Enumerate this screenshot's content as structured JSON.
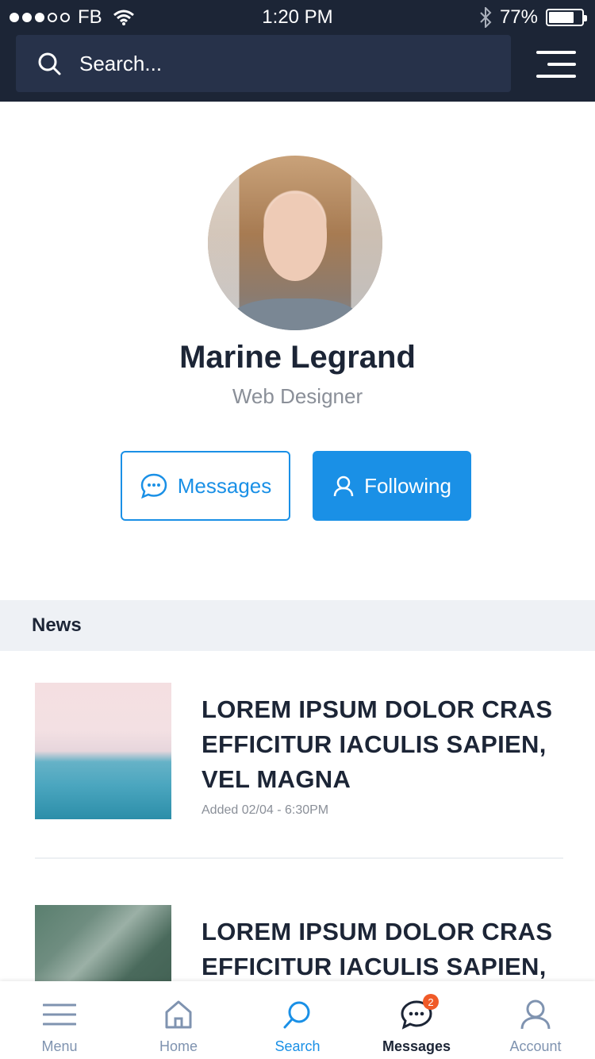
{
  "status_bar": {
    "carrier": "FB",
    "time": "1:20 PM",
    "battery_percent": "77%",
    "battery_level": 0.77,
    "signal_bars_filled": 3,
    "signal_bars_total": 5
  },
  "header": {
    "search_placeholder": "Search...",
    "menu_icon": "hamburger-icon"
  },
  "profile": {
    "name": "Marine Legrand",
    "role": "Web Designer",
    "messages_button": "Messages",
    "following_button": "Following"
  },
  "news": {
    "section_title": "News",
    "items": [
      {
        "title": "LOREM IPSUM DOLOR CRAS EFFICITUR IACULIS SAPIEN, VEL MAGNA",
        "date": "Added 02/04 - 6:30PM"
      },
      {
        "title": "LOREM IPSUM DOLOR CRAS EFFICITUR IACULIS SAPIEN, VEL",
        "date": ""
      }
    ]
  },
  "tabbar": {
    "tabs": [
      {
        "label": "Menu",
        "icon": "menu-icon"
      },
      {
        "label": "Home",
        "icon": "home-icon"
      },
      {
        "label": "Search",
        "icon": "search-icon"
      },
      {
        "label": "Messages",
        "icon": "chat-icon",
        "badge": "2"
      },
      {
        "label": "Account",
        "icon": "user-icon"
      }
    ],
    "active_tab": "Search"
  },
  "colors": {
    "header_bg": "#1c2536",
    "accent": "#1a90e6",
    "badge": "#f05a28"
  }
}
